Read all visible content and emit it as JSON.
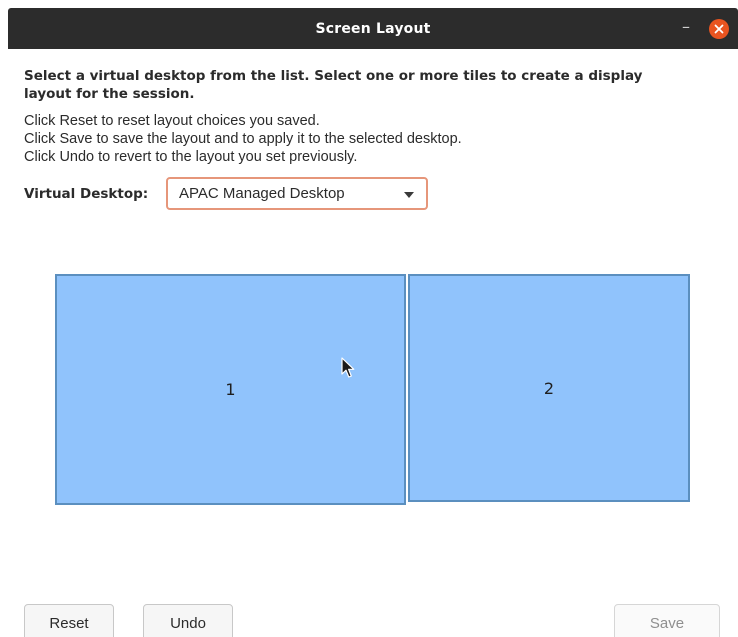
{
  "window": {
    "title": "Screen Layout",
    "minimize_glyph": "–"
  },
  "instructions": {
    "heading": "Select a virtual desktop from the list. Select one or more tiles to create a display layout for the session.",
    "lines": [
      "Click Reset to reset layout choices you saved.",
      "Click Save to save the layout and to apply it to the selected desktop.",
      "Click Undo to revert to the layout you set previously."
    ]
  },
  "virtual_desktop": {
    "label": "Virtual Desktop:",
    "selected": "APAC Managed Desktop"
  },
  "tiles": [
    {
      "label": "1"
    },
    {
      "label": "2"
    }
  ],
  "buttons": {
    "reset": "Reset",
    "undo": "Undo",
    "save": "Save"
  },
  "colors": {
    "titlebar": "#2c2c2c",
    "close_accent": "#e95420",
    "tile_fill": "#90c3fc",
    "tile_border": "#5b8fbf",
    "select_border": "#e6967a"
  },
  "icons": {
    "minimize": "minimize-icon",
    "close": "close-icon",
    "dropdown": "chevron-down-icon",
    "cursor": "mouse-pointer-icon"
  }
}
